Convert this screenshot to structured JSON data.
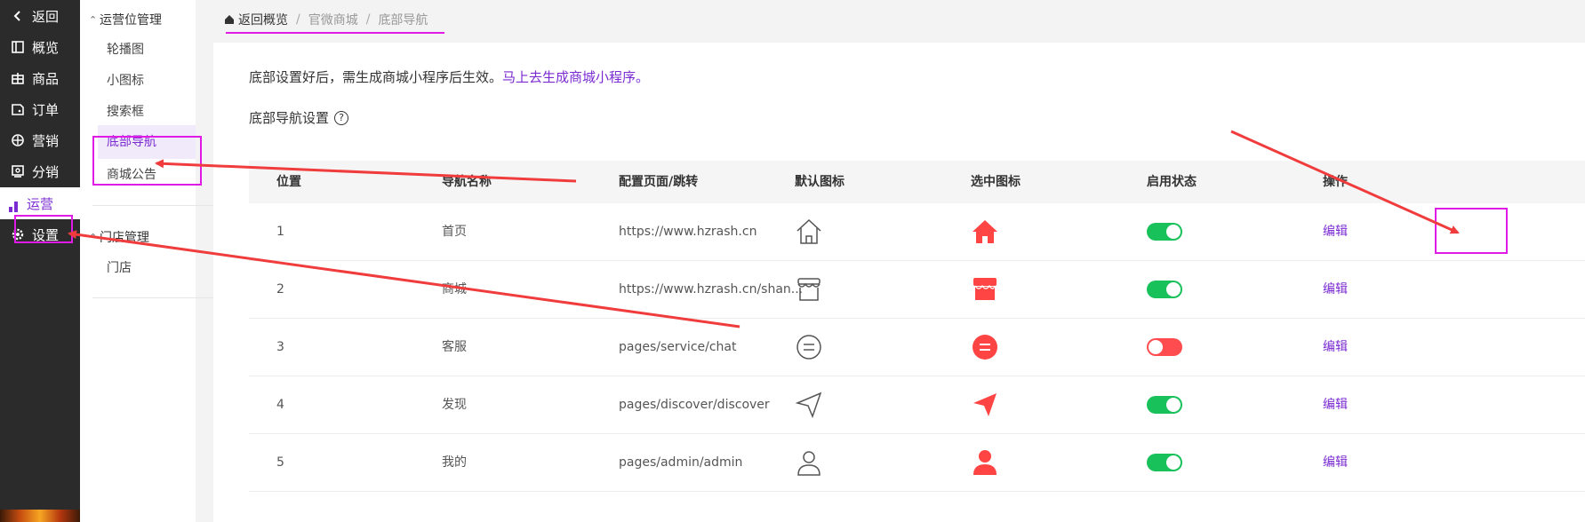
{
  "sidebar": {
    "items": [
      {
        "label": "返回",
        "icon": "chevron-left-icon"
      },
      {
        "label": "概览",
        "icon": "overview-icon"
      },
      {
        "label": "商品",
        "icon": "goods-icon"
      },
      {
        "label": "订单",
        "icon": "order-icon"
      },
      {
        "label": "营销",
        "icon": "marketing-icon"
      },
      {
        "label": "分销",
        "icon": "distribution-icon"
      },
      {
        "label": "运营",
        "icon": "operation-icon",
        "active": true
      },
      {
        "label": "设置",
        "icon": "gear-icon"
      }
    ]
  },
  "submenu": {
    "group1": "运营位管理",
    "group1_items": [
      "轮播图",
      "小图标",
      "搜索框",
      "底部导航",
      "商城公告"
    ],
    "group2": "门店管理",
    "group2_items": [
      "门店"
    ]
  },
  "breadcrumb": {
    "home": "返回概览",
    "crumb1": "官微商城",
    "crumb2": "底部导航"
  },
  "notice": {
    "text": "底部设置好后，需生成商城小程序后生效。",
    "link": "马上去生成商城小程序。"
  },
  "section_title": "底部导航设置",
  "table": {
    "headers": [
      "位置",
      "导航名称",
      "配置页面/跳转",
      "默认图标",
      "选中图标",
      "启用状态",
      "操作"
    ],
    "rows": [
      {
        "pos": "1",
        "name": "首页",
        "page": "https://www.hzrash.cn",
        "icon": "home-icon",
        "enabled": true,
        "action": "编辑"
      },
      {
        "pos": "2",
        "name": "商城",
        "page": "https://www.hzrash.cn/shan...",
        "icon": "shop-icon",
        "enabled": true,
        "action": "编辑"
      },
      {
        "pos": "3",
        "name": "客服",
        "page": "pages/service/chat",
        "icon": "chat-icon",
        "enabled": false,
        "action": "编辑"
      },
      {
        "pos": "4",
        "name": "发现",
        "page": "pages/discover/discover",
        "icon": "send-icon",
        "enabled": true,
        "action": "编辑"
      },
      {
        "pos": "5",
        "name": "我的",
        "page": "pages/admin/admin",
        "icon": "user-icon",
        "enabled": true,
        "action": "编辑"
      }
    ]
  },
  "colors": {
    "accent": "#7b2bd2",
    "selected_icon": "#ff4444",
    "toggle_on": "#19c15a",
    "toggle_off": "#ff4d4f",
    "annotation": "#e01be6",
    "arrow": "#f03c3c"
  }
}
